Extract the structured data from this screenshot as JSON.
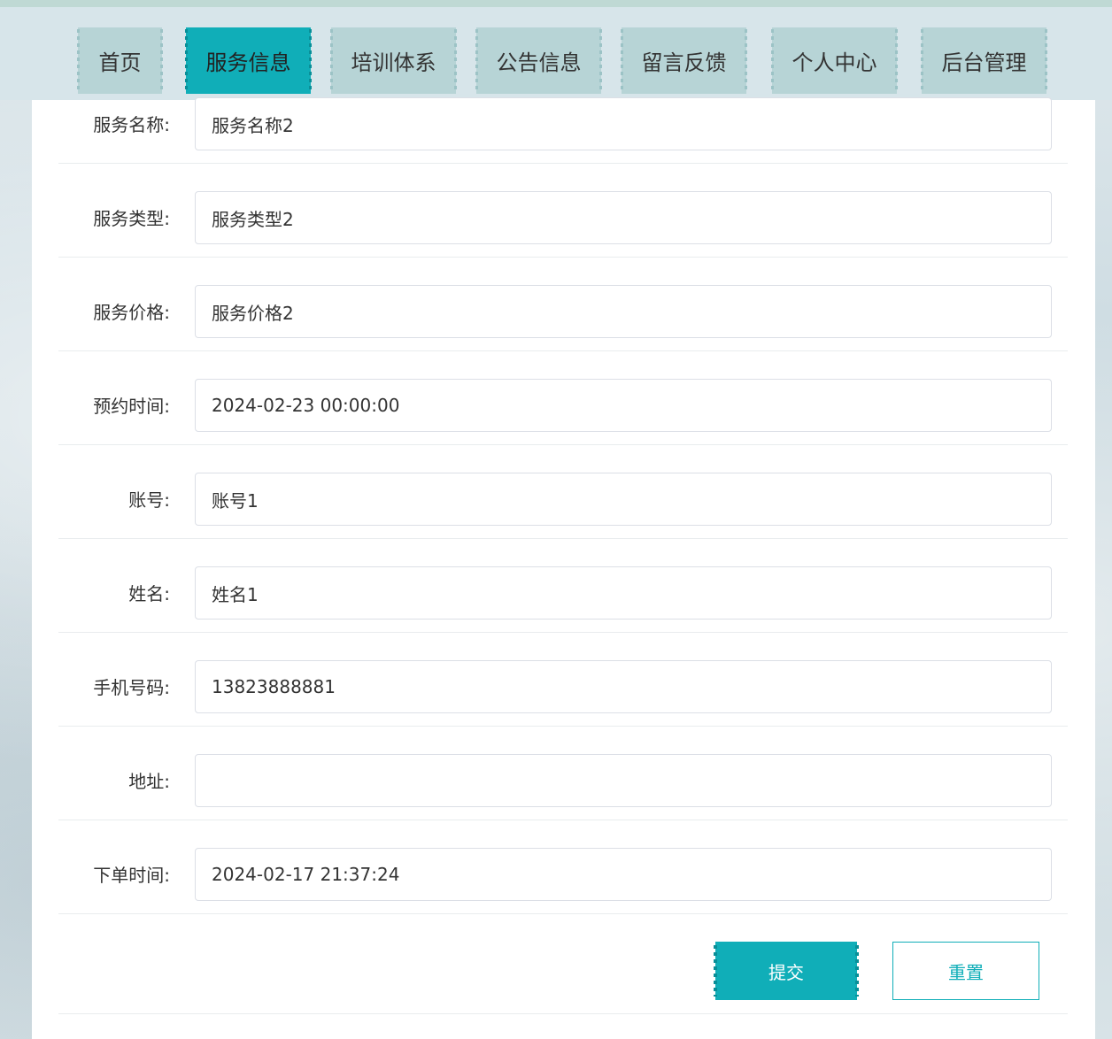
{
  "nav": {
    "items": [
      {
        "label": "首页",
        "active": false
      },
      {
        "label": "服务信息",
        "active": true
      },
      {
        "label": "培训体系",
        "active": false
      },
      {
        "label": "公告信息",
        "active": false
      },
      {
        "label": "留言反馈",
        "active": false
      },
      {
        "label": "个人中心",
        "active": false
      },
      {
        "label": "后台管理",
        "active": false
      }
    ]
  },
  "form": {
    "fields": [
      {
        "label": "服务名称:",
        "value": "服务名称2"
      },
      {
        "label": "服务类型:",
        "value": "服务类型2"
      },
      {
        "label": "服务价格:",
        "value": "服务价格2"
      },
      {
        "label": "预约时间:",
        "value": "2024-02-23 00:00:00"
      },
      {
        "label": "账号:",
        "value": "账号1"
      },
      {
        "label": "姓名:",
        "value": "姓名1"
      },
      {
        "label": "手机号码:",
        "value": "13823888881"
      },
      {
        "label": "地址:",
        "value": ""
      },
      {
        "label": "下单时间:",
        "value": "2024-02-17 21:37:24"
      }
    ],
    "submit_label": "提交",
    "reset_label": "重置"
  },
  "colors": {
    "accent": "#10aeb8",
    "nav_bg": "#b7d4d6",
    "border": "#dcdfe6"
  }
}
